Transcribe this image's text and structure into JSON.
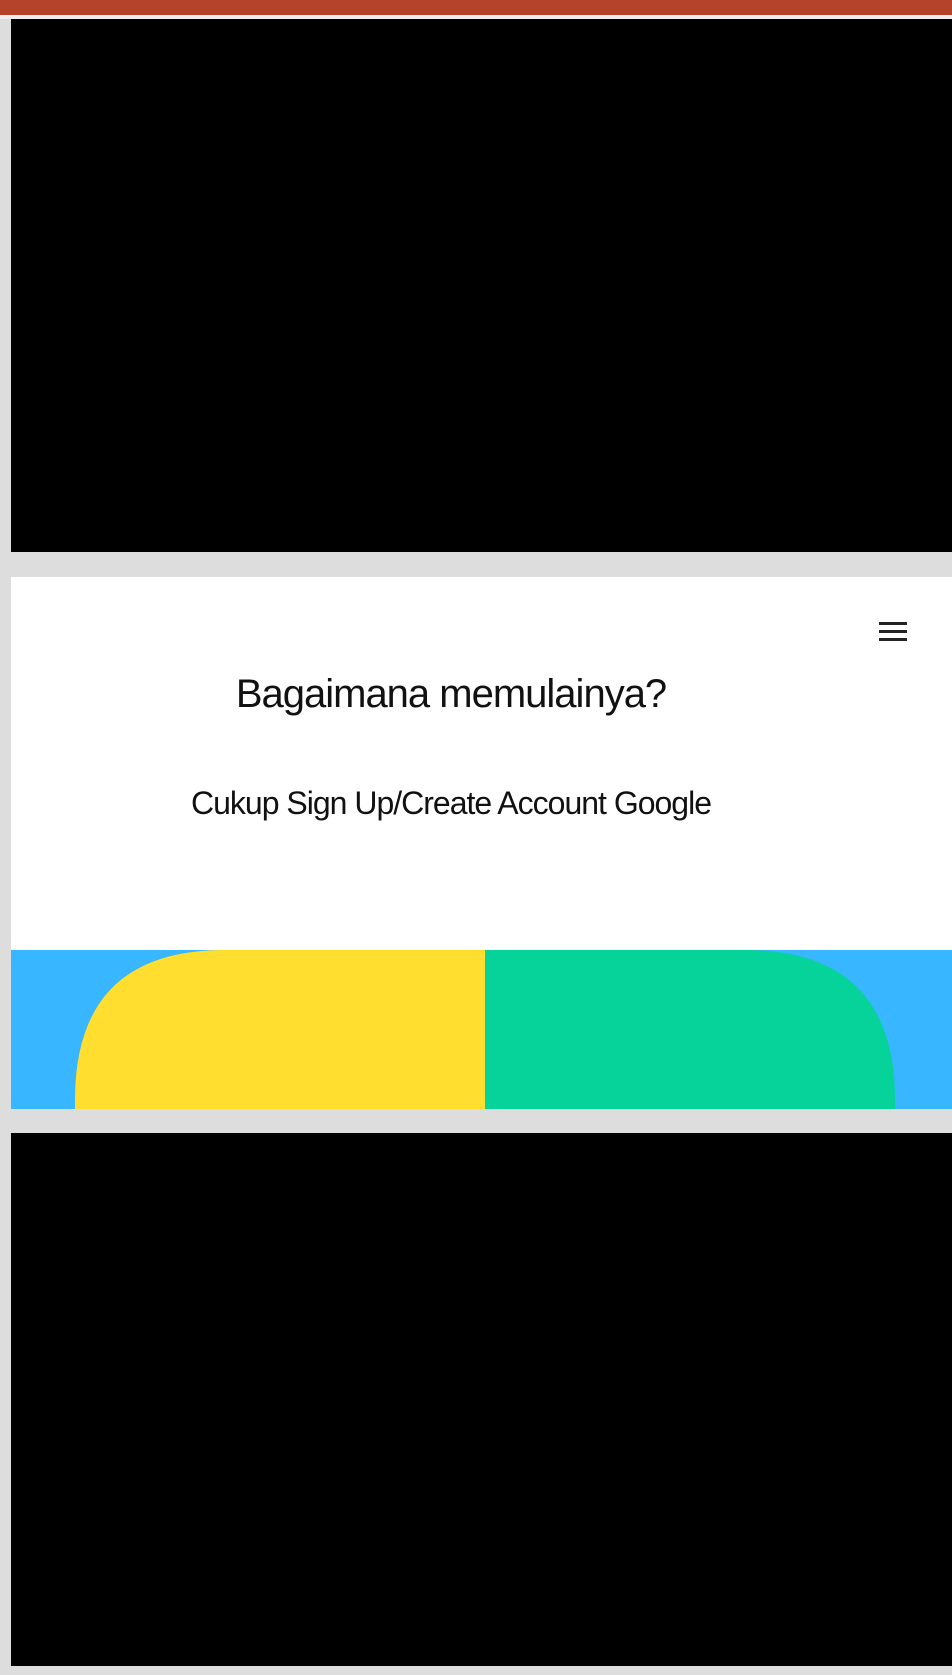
{
  "slide": {
    "title": "Bagaimana memulainya?",
    "subtitle": "Cukup Sign Up/Create Account Google",
    "menu_icon": "hamburger-menu-icon"
  },
  "colors": {
    "top_bar": "#b5432b",
    "banner_background": "#38b6ff",
    "banner_left_shape": "#ffde2f",
    "banner_right_shape": "#06d39a",
    "video_background": "#000000"
  }
}
